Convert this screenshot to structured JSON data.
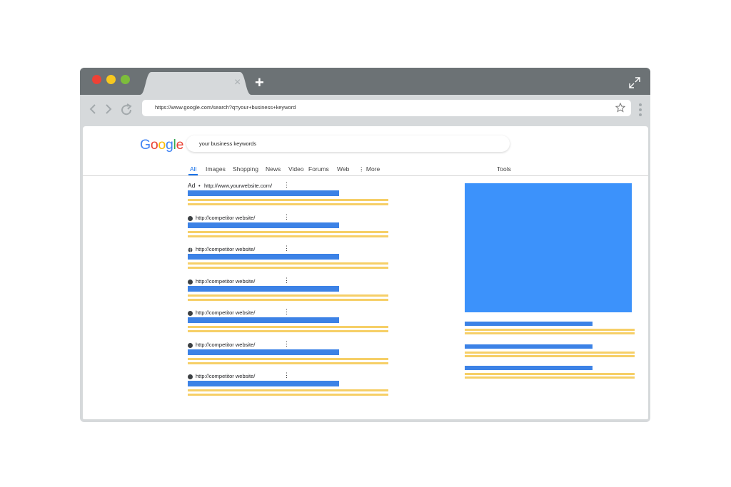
{
  "browser": {
    "url": "https://www.google.com/search?q=your+business+keyword",
    "tab_close": "×",
    "new_tab": "+"
  },
  "search": {
    "logo": [
      "G",
      "o",
      "o",
      "g",
      "l",
      "e"
    ],
    "logo_colors": [
      "#4285f4",
      "#ea4335",
      "#fbbc05",
      "#4285f4",
      "#34a853",
      "#ea4335"
    ],
    "query": "your business keywords"
  },
  "tabs": [
    "All",
    "Images",
    "Shopping",
    "News",
    "Video",
    "Forums",
    "Web",
    "⋮ More"
  ],
  "tools": "Tools",
  "results": [
    {
      "ad": true,
      "ad_label": "Ad",
      "url": "http://www.yourwebsite.com/"
    },
    {
      "ad": false,
      "url": "http://competitor website/"
    },
    {
      "ad": false,
      "url": "http://competitor website/"
    },
    {
      "ad": false,
      "url": "http://competitor website/"
    },
    {
      "ad": false,
      "url": "http://competitor website/"
    },
    {
      "ad": false,
      "url": "http://competitor website/"
    },
    {
      "ad": false,
      "url": "http://competitor website/"
    }
  ],
  "colors": {
    "title_bar": "#3c82e6",
    "snippet_bar": "#f6cf67",
    "knowledge_panel": "#3c92fb"
  }
}
